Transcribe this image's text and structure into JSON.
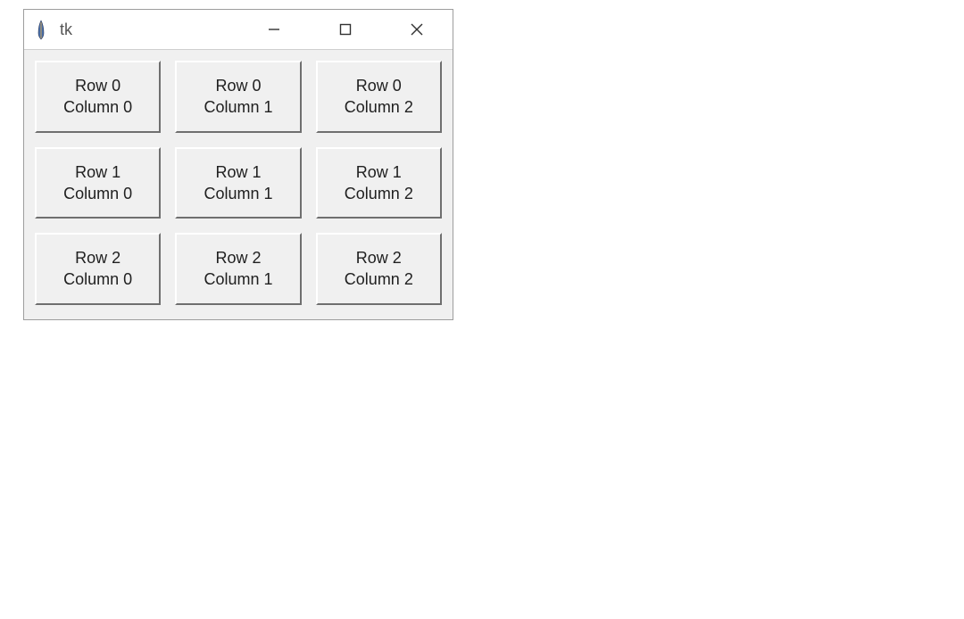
{
  "window": {
    "title": "tk",
    "icon": "tk-feather-icon"
  },
  "grid": {
    "rows": [
      [
        {
          "line1": "Row 0",
          "line2": "Column 0"
        },
        {
          "line1": "Row 0",
          "line2": "Column 1"
        },
        {
          "line1": "Row 0",
          "line2": "Column 2"
        }
      ],
      [
        {
          "line1": "Row 1",
          "line2": "Column 0"
        },
        {
          "line1": "Row 1",
          "line2": "Column 1"
        },
        {
          "line1": "Row 1",
          "line2": "Column 2"
        }
      ],
      [
        {
          "line1": "Row 2",
          "line2": "Column 0"
        },
        {
          "line1": "Row 2",
          "line2": "Column 1"
        },
        {
          "line1": "Row 2",
          "line2": "Column 2"
        }
      ]
    ]
  }
}
